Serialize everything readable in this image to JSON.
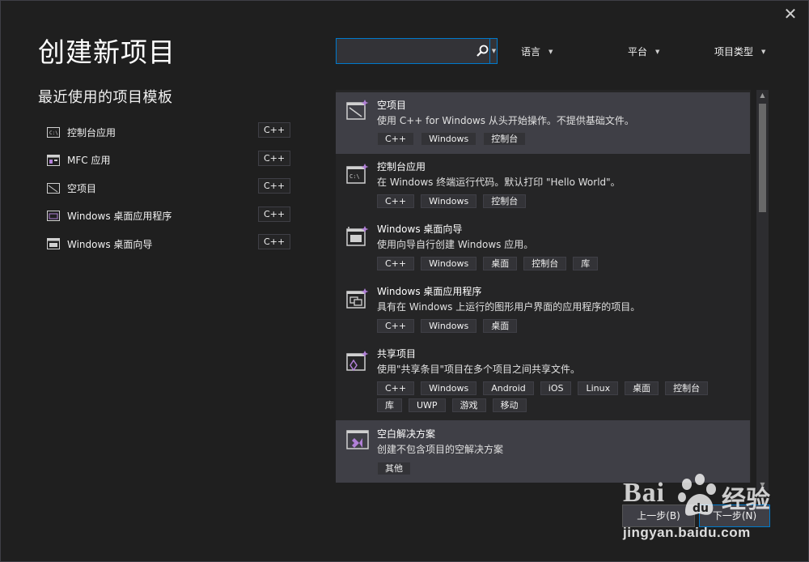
{
  "window": {
    "close_label": "✕",
    "page_title": "创建新项目",
    "recent_title": "最近使用的项目模板"
  },
  "recent": [
    {
      "label": "控制台应用",
      "tag": "C++",
      "icon": "console-app-icon"
    },
    {
      "label": "MFC 应用",
      "tag": "C++",
      "icon": "mfc-app-icon"
    },
    {
      "label": "空项目",
      "tag": "C++",
      "icon": "empty-project-icon"
    },
    {
      "label": "Windows 桌面应用程序",
      "tag": "C++",
      "icon": "desktop-app-icon"
    },
    {
      "label": "Windows 桌面向导",
      "tag": "C++",
      "icon": "desktop-wizard-icon"
    }
  ],
  "search": {
    "value": "",
    "placeholder": ""
  },
  "filters": {
    "language": "语言",
    "platform": "平台",
    "project_type": "项目类型"
  },
  "templates": [
    {
      "name": "空项目",
      "desc": "使用 C++ for Windows 从头开始操作。不提供基础文件。",
      "tags": [
        "C++",
        "Windows",
        "控制台"
      ],
      "selected": true,
      "icon": "empty-project-icon"
    },
    {
      "name": "控制台应用",
      "desc": "在 Windows 终端运行代码。默认打印 \"Hello World\"。",
      "tags": [
        "C++",
        "Windows",
        "控制台"
      ],
      "selected": false,
      "icon": "console-app-icon"
    },
    {
      "name": "Windows 桌面向导",
      "desc": "使用向导自行创建 Windows 应用。",
      "tags": [
        "C++",
        "Windows",
        "桌面",
        "控制台",
        "库"
      ],
      "selected": false,
      "icon": "desktop-wizard-icon"
    },
    {
      "name": "Windows 桌面应用程序",
      "desc": "具有在 Windows 上运行的图形用户界面的应用程序的项目。",
      "tags": [
        "C++",
        "Windows",
        "桌面"
      ],
      "selected": false,
      "icon": "desktop-app-icon"
    },
    {
      "name": "共享项目",
      "desc": "使用\"共享条目\"项目在多个项目之间共享文件。",
      "tags": [
        "C++",
        "Windows",
        "Android",
        "iOS",
        "Linux",
        "桌面",
        "控制台",
        "库",
        "UWP",
        "游戏",
        "移动"
      ],
      "selected": false,
      "icon": "shared-project-icon"
    },
    {
      "name": "空白解决方案",
      "desc": "创建不包含项目的空解决方案",
      "tags": [
        "其他"
      ],
      "selected": true,
      "icon": "blank-solution-icon"
    }
  ],
  "buttons": {
    "back": "上一步(B)",
    "next": "下一步(N)"
  },
  "watermark": {
    "brand": "Bai",
    "cn": "经验",
    "url": "jingyan.baidu.com"
  },
  "colors": {
    "accent": "#007acc",
    "background": "#1f1f1f",
    "selected": "#3f3f46",
    "vs_purple": "#b180d7"
  }
}
